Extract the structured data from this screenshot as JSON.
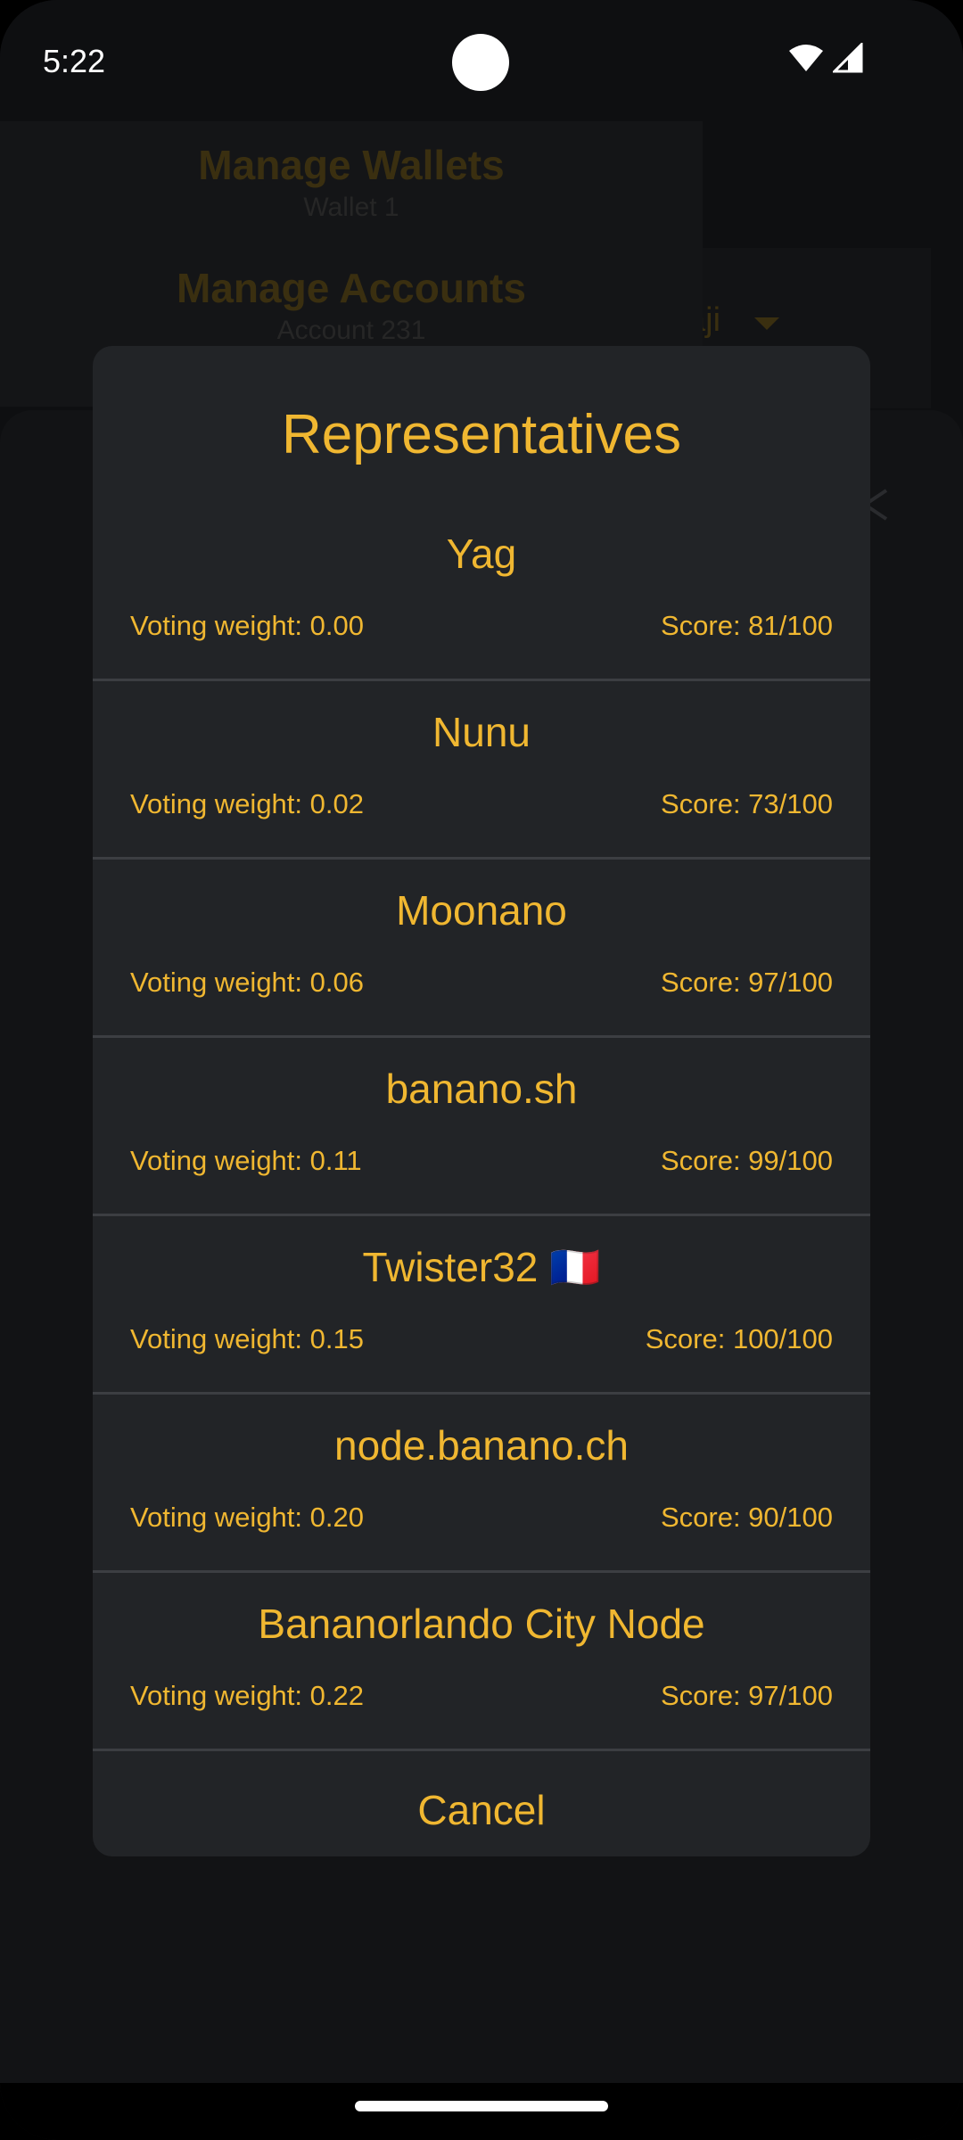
{
  "status_bar": {
    "time": "5:22"
  },
  "background": {
    "drawer": [
      {
        "title": "Manage Wallets",
        "subtitle": "Wallet 1"
      },
      {
        "title": "Manage Accounts",
        "subtitle": "Account 231"
      }
    ],
    "account_selector_text": "aji"
  },
  "dialog": {
    "title": "Representatives",
    "representatives": [
      {
        "name": "Yag",
        "weight": "Voting weight: 0.00",
        "score": "Score: 81/100"
      },
      {
        "name": "Nunu",
        "weight": "Voting weight: 0.02",
        "score": "Score: 73/100"
      },
      {
        "name": "Moonano",
        "weight": "Voting weight: 0.06",
        "score": "Score: 97/100"
      },
      {
        "name": "banano.sh",
        "weight": "Voting weight: 0.11",
        "score": "Score: 99/100"
      },
      {
        "name": "Twister32 🇫🇷",
        "weight": "Voting weight: 0.15",
        "score": "Score: 100/100"
      },
      {
        "name": "node.banano.ch",
        "weight": "Voting weight: 0.20",
        "score": "Score: 90/100"
      },
      {
        "name": "Bananorlando City Node",
        "weight": "Voting weight: 0.22",
        "score": "Score: 97/100"
      }
    ],
    "cancel_label": "Cancel"
  },
  "colors": {
    "accent": "#f0b731",
    "dialog_bg": "#222427",
    "screen_bg": "#0e0f11",
    "divider": "#3c3e42"
  },
  "icons": {
    "wifi": "wifi-icon",
    "signal": "signal-icon",
    "close": "close-icon"
  }
}
